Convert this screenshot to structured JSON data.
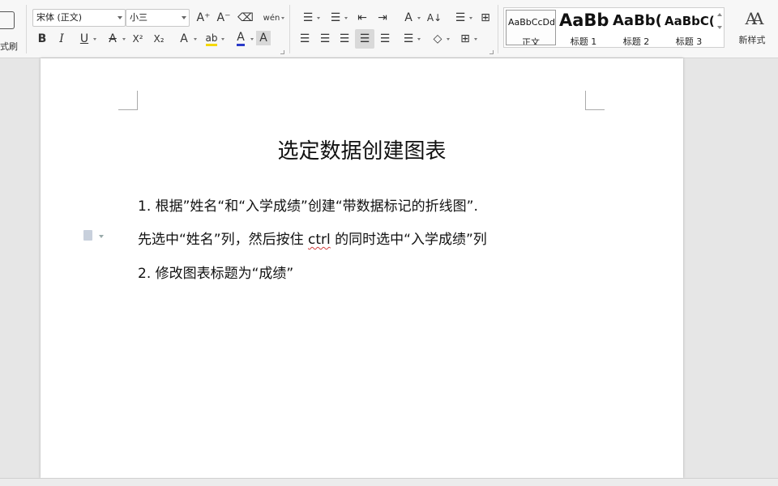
{
  "ribbon": {
    "format_painter_label": "式刷",
    "font_name": "宋体 (正文)",
    "font_size": "小三",
    "buttons": {
      "grow_font": "A⁺",
      "shrink_font": "A⁻",
      "clear_format": "⌫",
      "phonetic": "wén",
      "bold": "B",
      "italic": "I",
      "underline": "U",
      "strikethrough": "A",
      "superscript": "X²",
      "subscript": "X₂",
      "text_effect": "A",
      "highlight": "ab",
      "font_color": "A",
      "char_shading": "A",
      "bullets": "☰",
      "numbering": "☰",
      "decrease_indent": "⇤",
      "increase_indent": "⇥",
      "chinese_layout": "A",
      "sort": "A↓",
      "line_spacing_menu": "☰",
      "show_marks": "⊞",
      "align_left": "☰",
      "align_center": "☰",
      "align_right": "☰",
      "justify": "☰",
      "distribute": "☰",
      "line_spacing": "☰",
      "shading": "◇",
      "borders": "⊞"
    },
    "styles": [
      {
        "sample": "AaBbCcDd",
        "name": "正文"
      },
      {
        "sample": "AaBb",
        "name": "标题 1"
      },
      {
        "sample": "AaBb(",
        "name": "标题 2"
      },
      {
        "sample": "AaBbC(",
        "name": "标题 3"
      }
    ],
    "new_style_label": "新样式",
    "colors": {
      "highlight": "#f5d800",
      "font_color": "#2a3ac8"
    }
  },
  "document": {
    "title": "选定数据创建图表",
    "paragraphs": {
      "p1": "1.  根据”姓名“和“入学成绩”创建“带数据标记的折线图”.",
      "p2_before": "先选中“姓名”列，然后按住 ",
      "p2_ctrl": "ctrl",
      "p2_after": " 的同时选中“入学成绩”列",
      "p3": "2.  修改图表标题为“成绩”"
    }
  }
}
